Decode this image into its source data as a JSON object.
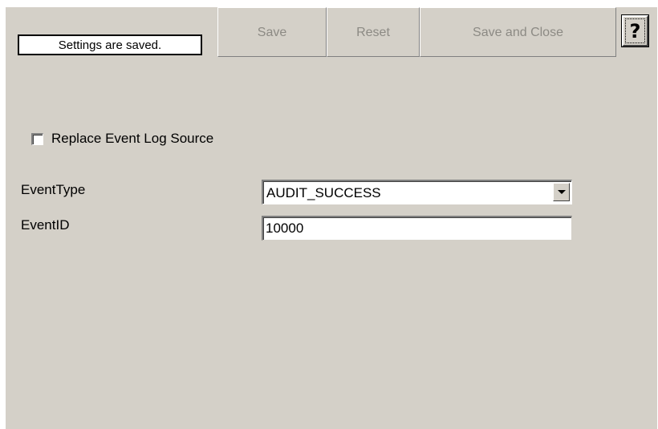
{
  "toolbar": {
    "status_text": "Settings are saved.",
    "save_label": "Save",
    "reset_label": "Reset",
    "save_close_label": "Save and Close",
    "help_label": "?"
  },
  "form": {
    "replace_event_log_source": {
      "label": "Replace Event Log Source",
      "checked": false
    },
    "event_type": {
      "label": "EventType",
      "value": "AUDIT_SUCCESS"
    },
    "event_id": {
      "label": "EventID",
      "value": "10000"
    }
  },
  "colors": {
    "background": "#d4d0c8",
    "disabled_text": "#8c8a84"
  },
  "icons": {
    "dropdown": "chevron-down-icon",
    "help": "help-icon"
  }
}
